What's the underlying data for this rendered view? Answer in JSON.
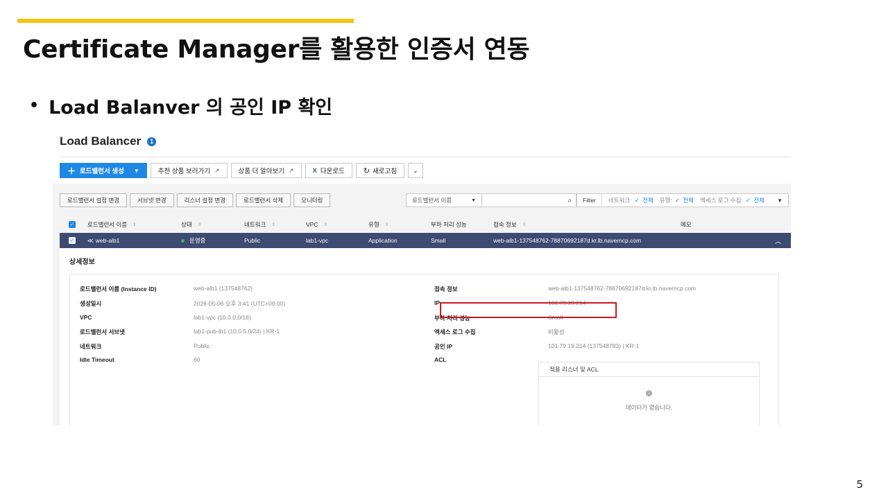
{
  "slide": {
    "title": "Certificate Manager를 활용한 인증서 연동",
    "bullet": "Load Balanver 의 공인 IP 확인",
    "page_number": "5",
    "accent_color": "#f5c518"
  },
  "lb": {
    "title": "Load Balancer",
    "count": "1",
    "toolbar": {
      "create": "로드밸런서 생성",
      "recommend": "추천 상품 보러가기",
      "learn_more": "상품 더 알아보기",
      "download": "다운로드",
      "refresh": "새로고침"
    },
    "actions": [
      "로드밸런서 설정 변경",
      "서브넷 변경",
      "리스너 설정 변경",
      "로드밸런서 삭제",
      "모니터링"
    ],
    "search": {
      "select_value": "로드밸런서 이름",
      "filter_label": "Filter",
      "network_label": "네트워크:",
      "network_value": "전체",
      "type_label": "유형:",
      "type_value": "전체",
      "access_log_label": "엑세스 로그 수집:",
      "access_log_value": "전체"
    },
    "columns": {
      "name": "로드밸런서 이름",
      "status": "상태",
      "network": "네트워크",
      "vpc": "VPC",
      "type": "유형",
      "capacity": "부하 처리 성능",
      "endpoint": "접속 정보",
      "memo": "메모"
    },
    "row": {
      "name": "web-alb1",
      "status": "운영중",
      "network": "Public",
      "vpc": "lab1-vpc",
      "type": "Application",
      "capacity": "Small",
      "endpoint": "web-alb1-137548762-78870692187d.kr.lb.naverncp.com"
    },
    "detail": {
      "title": "상세정보",
      "left": [
        {
          "key": "로드밸런서 이름 (Instance ID)",
          "value": "web-alb1 (137548762)"
        },
        {
          "key": "생성일시",
          "value": "2026-05-06 오후 3:41 (UTC+09:00)"
        },
        {
          "key": "VPC",
          "value": "lab1-vpc (10.0.0.0/16)"
        },
        {
          "key": "로드밸런서 서브넷",
          "value": "lab1-pub-lb1 (10.0.5.0/24) | KR-1"
        },
        {
          "key": "네트워크",
          "value": "Public"
        },
        {
          "key": "Idle Timeout",
          "value": "60"
        }
      ],
      "right": [
        {
          "key": "접속 정보",
          "value": "web-alb1-137548762-78870692187d.kr.lb.naverncp.com"
        },
        {
          "key": "IP",
          "value": "101.79.19.214"
        },
        {
          "key": "부하 처리 성능",
          "value": "Small"
        },
        {
          "key": "엑세스 로그 수집",
          "value": "비활성"
        },
        {
          "key": "공인 IP",
          "value": "101.79.19.214 (137548783) | KR-1"
        },
        {
          "key": "ACL",
          "value": ""
        }
      ],
      "acl_table_header": "적용 리스너 및 ACL",
      "acl_empty": "데이터가 없습니다."
    }
  }
}
